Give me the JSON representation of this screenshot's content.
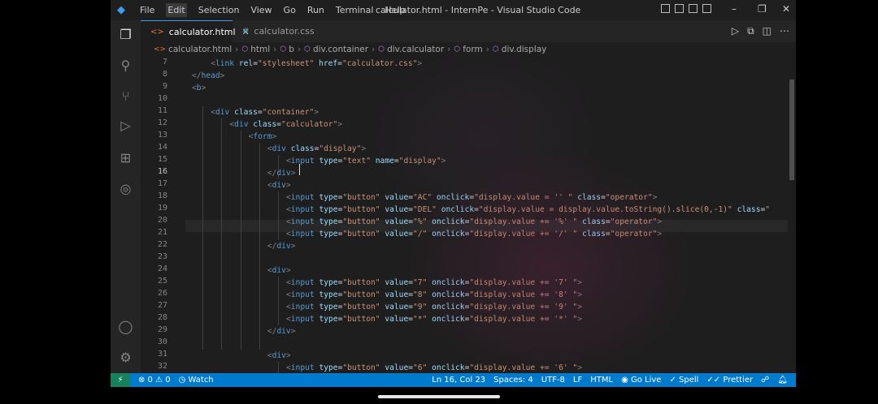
{
  "menu": [
    "File",
    "Edit",
    "Selection",
    "View",
    "Go",
    "Run",
    "Terminal",
    "Help"
  ],
  "window_title": "calculator.html - InternPe - Visual Studio Code",
  "tabs": [
    {
      "label": "calculator.html",
      "icon": "html-file-icon"
    },
    {
      "label": "calculator.css",
      "icon": "css-file-icon"
    }
  ],
  "breadcrumb": [
    "calculator.html",
    "html",
    "b",
    "div.container",
    "div.calculator",
    "form",
    "div.display"
  ],
  "line_numbers": [
    "7",
    "8",
    "9",
    "10",
    "11",
    "12",
    "13",
    "14",
    "15",
    "16",
    "17",
    "18",
    "19",
    "20",
    "21",
    "22",
    "23",
    "24",
    "25",
    "26",
    "27",
    "28",
    "29",
    "30",
    "31",
    "32"
  ],
  "code_lines": [
    "<link rel=\"stylesheet\" href=\"calculator.css\">",
    "</head>",
    "<b>",
    "",
    "<div class=\"container\">",
    "<div class=\"calculator\">",
    "<form>",
    "<div class=\"display\">",
    "<input type=\"text\" name=\"display\">",
    "</div>",
    "<div>",
    "<input type=\"button\" value=\"AC\" onclick=\"display.value = '' \" class=\"operator\">",
    "<input type=\"button\" value=\"DEL\" onclick=\"display.value = display.value.toString().slice(0,-1)\" class=\"",
    "<input type=\"button\" value=\"%\" onclick=\"display.value += '%' \" class=\"operator\">",
    "<input type=\"button\" value=\"/\" onclick=\"display.value += '/' \" class=\"operator\">",
    "</div>",
    "",
    "<div>",
    "<input type=\"button\" value=\"7\" onclick=\"display.value += '7' \">",
    "<input type=\"button\" value=\"8\" onclick=\"display.value += '8' \">",
    "<input type=\"button\" value=\"9\" onclick=\"display.value += '9' \">",
    "<input type=\"button\" value=\"*\" onclick=\"display.value += '*' \">",
    "</div>",
    "",
    "<div>",
    "<input type=\"button\" value=\"6\" onclick=\"display.value += '6' \">"
  ],
  "status": {
    "problems": "⊗ 0 ⚠ 0",
    "watch": "Watch",
    "position": "Ln 16, Col 23",
    "spaces": "Spaces: 4",
    "encoding": "UTF-8",
    "eol": "LF",
    "language": "HTML",
    "go_live": "Go Live",
    "spell": "Spell",
    "prettier": "Prettier"
  },
  "colors": {
    "status_bar": "#007acc",
    "editor_bg": "#1e1e1e",
    "tag": "#569cd6",
    "attribute": "#9cdcfe",
    "string": "#ce9178"
  }
}
